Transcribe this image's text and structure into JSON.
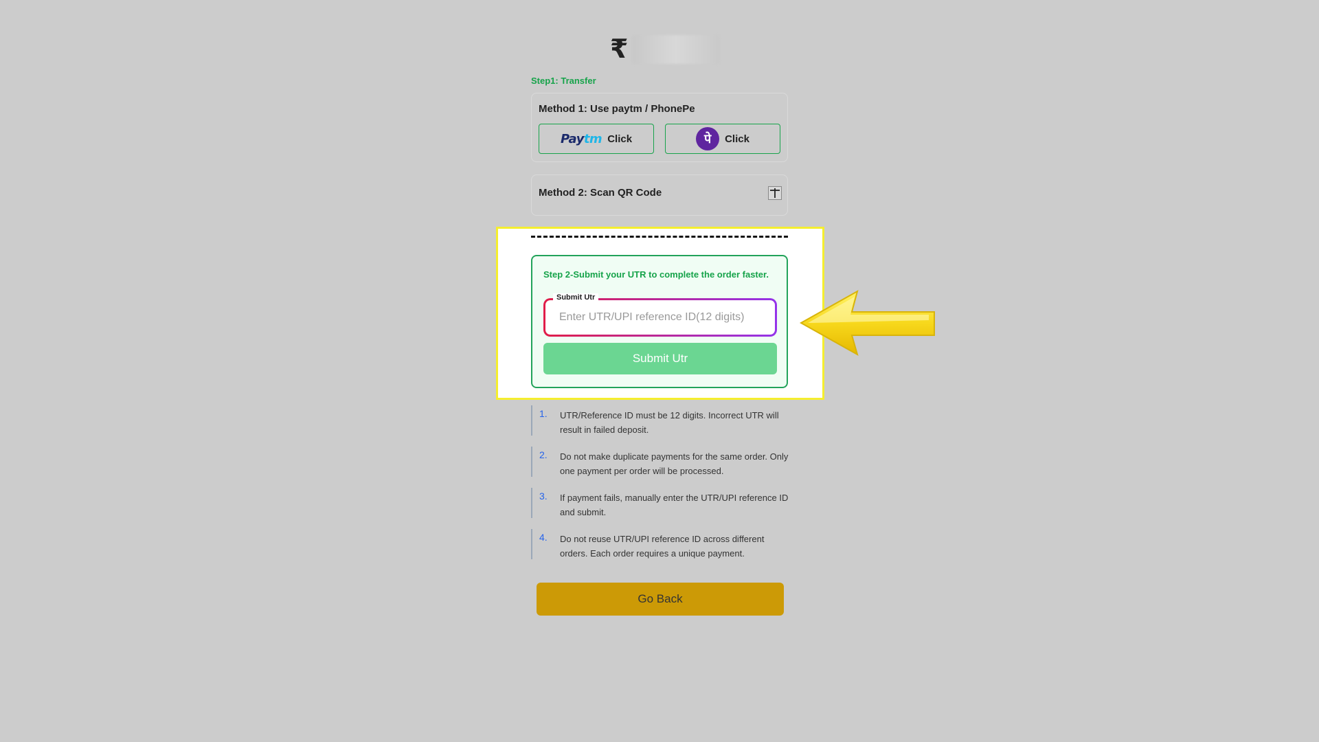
{
  "header": {
    "currency_symbol": "₹"
  },
  "step1": {
    "label": "Step1: Transfer",
    "method1": {
      "title": "Method 1: Use paytm / PhonePe",
      "paytm": {
        "logo_pay": "Pay",
        "logo_tm": "tm",
        "label": "Click"
      },
      "phonepe": {
        "logo": "पे",
        "label": "Click"
      }
    },
    "method2": {
      "title": "Method 2: Scan QR Code",
      "expand_icon": "plus-icon"
    }
  },
  "step2": {
    "text": "Step 2-Submit your UTR to complete the order faster.",
    "field_label": "Submit Utr",
    "placeholder": "Enter UTR/UPI reference ID(12 digits)",
    "submit_label": "Submit Utr"
  },
  "instructions": [
    {
      "num": "1.",
      "text": "UTR/Reference ID must be 12 digits. Incorrect UTR will result in failed deposit."
    },
    {
      "num": "2.",
      "text": "Do not make duplicate payments for the same order. Only one payment per order will be processed."
    },
    {
      "num": "3.",
      "text": "If payment fails, manually enter the UTR/UPI reference ID and submit."
    },
    {
      "num": "4.",
      "text": "Do not reuse UTR/UPI reference ID across different orders. Each order requires a unique payment."
    }
  ],
  "footer": {
    "go_back_label": "Go Back"
  },
  "colors": {
    "background": "#cccccc",
    "accent_green": "#16a34a",
    "submit_green": "#6bd692",
    "go_back_gold": "#cc9a06",
    "highlight_yellow": "#f5ee2e",
    "phonepe_purple": "#5f259f"
  },
  "annotation_icon": "yellow-arrow-icon"
}
